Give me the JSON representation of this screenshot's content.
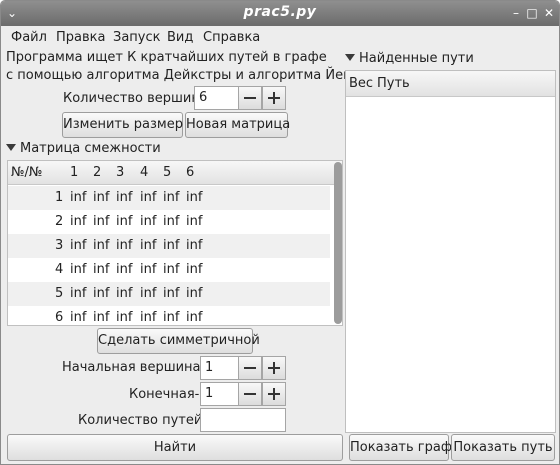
{
  "window": {
    "title": "prac5.py",
    "menu_icon": "chevron-down-icon",
    "minimize_icon": "minimize-icon",
    "maximize_icon": "maximize-icon",
    "close_icon": "close-icon"
  },
  "menubar": {
    "items": [
      {
        "label": "Файл"
      },
      {
        "label": "Правка"
      },
      {
        "label": "Запуск"
      },
      {
        "label": "Вид"
      },
      {
        "label": "Справка"
      }
    ]
  },
  "description": {
    "line1": "Программа ищет К кратчайших путей в графе",
    "line2": "с помощью алгоритма Дейкстры и алгоритма Йена."
  },
  "vertex_count": {
    "label": "Количество вершин-",
    "value": "6"
  },
  "buttons": {
    "resize": "Изменить размер",
    "new_matrix": "Новая матрица",
    "make_symmetric": "Сделать симметричной",
    "find": "Найти",
    "show_graph": "Показать граф",
    "show_path": "Показать путь"
  },
  "adjacency": {
    "title": "Матрица смежности",
    "corner_header": "№/№",
    "column_headers": [
      "1",
      "2",
      "3",
      "4",
      "5",
      "6"
    ],
    "rows": [
      {
        "index": "1",
        "cells": [
          "inf",
          "inf",
          "inf",
          "inf",
          "inf",
          "inf"
        ]
      },
      {
        "index": "2",
        "cells": [
          "inf",
          "inf",
          "inf",
          "inf",
          "inf",
          "inf"
        ]
      },
      {
        "index": "3",
        "cells": [
          "inf",
          "inf",
          "inf",
          "inf",
          "inf",
          "inf"
        ]
      },
      {
        "index": "4",
        "cells": [
          "inf",
          "inf",
          "inf",
          "inf",
          "inf",
          "inf"
        ]
      },
      {
        "index": "5",
        "cells": [
          "inf",
          "inf",
          "inf",
          "inf",
          "inf",
          "inf"
        ]
      },
      {
        "index": "6",
        "cells": [
          "inf",
          "inf",
          "inf",
          "inf",
          "inf",
          "inf"
        ]
      }
    ]
  },
  "start_vertex": {
    "label": "Начальная вершина-",
    "value": "1"
  },
  "end_vertex": {
    "label": "Конечная-",
    "value": "1"
  },
  "path_count": {
    "label": "Количество путей-",
    "value": ""
  },
  "found_paths": {
    "title": "Найденные пути",
    "col_weight": "Вес",
    "col_path": "Путь"
  },
  "colors": {
    "window_bg": "#ededed",
    "titlebar": "#7d7d7d",
    "row_alt": "#f0f0f0"
  }
}
